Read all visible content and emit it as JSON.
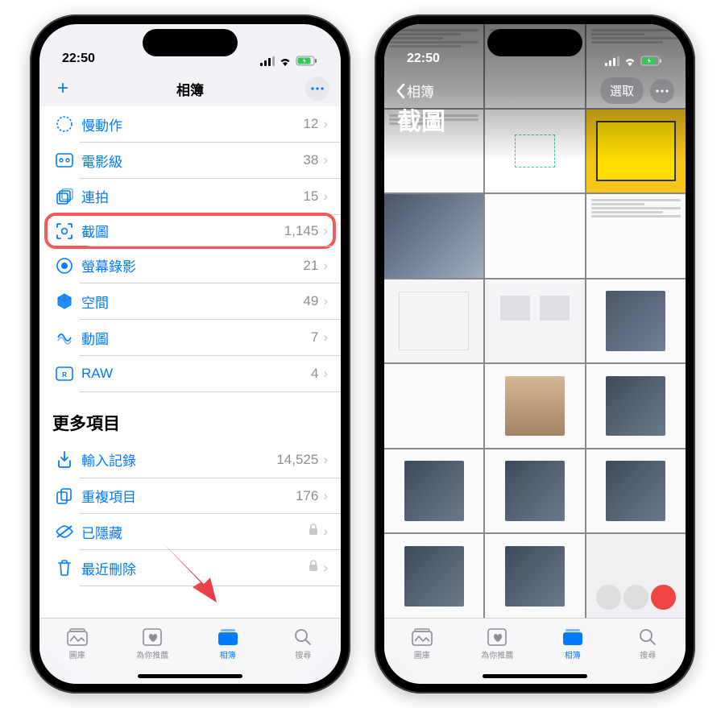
{
  "colors": {
    "accent": "#007aff",
    "highlight": "#f25a5a",
    "muted": "#8e8e93"
  },
  "phone1": {
    "status": {
      "time": "22:50"
    },
    "nav": {
      "title": "相簿",
      "add_symbol": "+"
    },
    "rows": [
      {
        "icon": "slowmo",
        "label": "慢動作",
        "count": "12"
      },
      {
        "icon": "cinematic",
        "label": "電影級",
        "count": "38"
      },
      {
        "icon": "burst",
        "label": "連拍",
        "count": "15"
      },
      {
        "icon": "screenshot",
        "label": "截圖",
        "count": "1,145",
        "highlighted": true
      },
      {
        "icon": "screenrec",
        "label": "螢幕錄影",
        "count": "21"
      },
      {
        "icon": "spatial",
        "label": "空間",
        "count": "49"
      },
      {
        "icon": "gif",
        "label": "動圖",
        "count": "7"
      },
      {
        "icon": "raw",
        "label": "RAW",
        "count": "4"
      }
    ],
    "section2_title": "更多項目",
    "rows2": [
      {
        "icon": "import",
        "label": "輸入記錄",
        "count": "14,525"
      },
      {
        "icon": "duplicate",
        "label": "重複項目",
        "count": "176"
      },
      {
        "icon": "hidden",
        "label": "已隱藏",
        "locked": true
      },
      {
        "icon": "trash",
        "label": "最近刪除",
        "locked": true
      }
    ],
    "tabs": [
      {
        "icon": "library",
        "label": "圖庫"
      },
      {
        "icon": "foryou",
        "label": "為你推薦"
      },
      {
        "icon": "albums",
        "label": "相簿",
        "active": true
      },
      {
        "icon": "search",
        "label": "搜尋"
      }
    ]
  },
  "phone2": {
    "status": {
      "time": "22:50"
    },
    "back_label": "相簿",
    "title": "截圖",
    "select_label": "選取",
    "tabs": [
      {
        "icon": "library",
        "label": "圖庫"
      },
      {
        "icon": "foryou",
        "label": "為你推薦"
      },
      {
        "icon": "albums",
        "label": "相簿",
        "active": true
      },
      {
        "icon": "search",
        "label": "搜尋"
      }
    ]
  }
}
